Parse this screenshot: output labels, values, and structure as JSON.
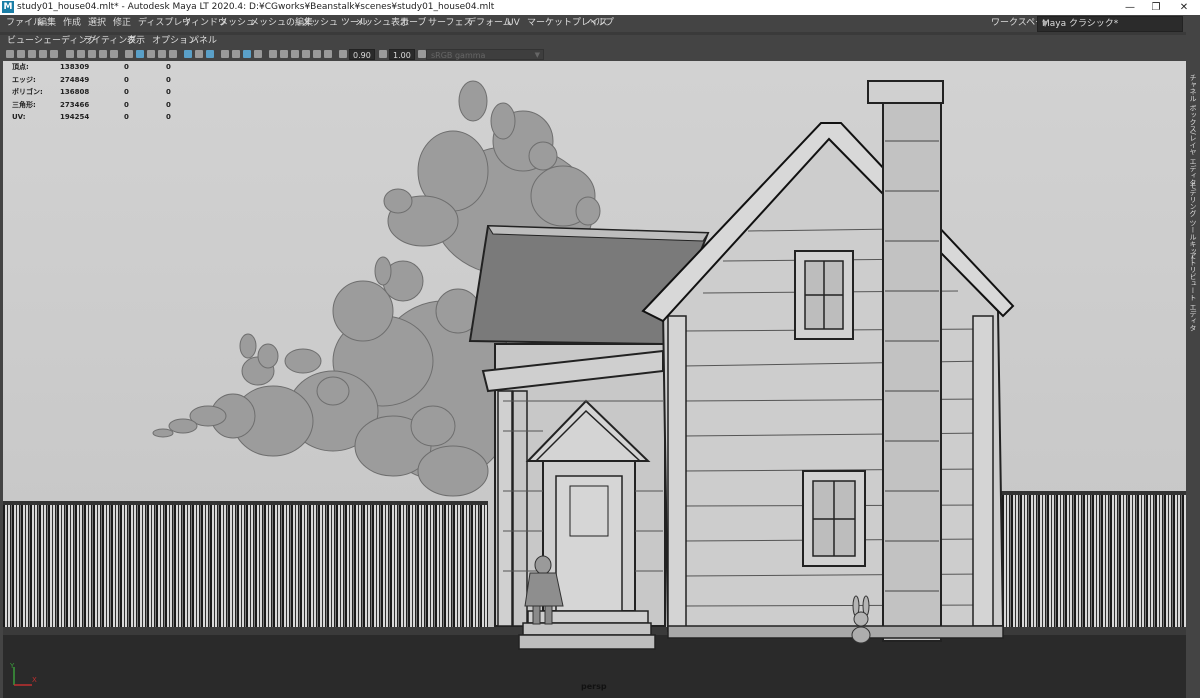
{
  "window": {
    "title": "study01_house04.mlt* - Autodesk Maya LT 2020.4: D:¥CGworks¥Beanstalk¥scenes¥study01_house04.mlt",
    "app_icon": "M",
    "controls": {
      "minimize": "—",
      "restore": "❐",
      "close": "✕"
    }
  },
  "menubar": {
    "items": [
      "ファイル",
      "編集",
      "作成",
      "選択",
      "修正",
      "ディスプレイ",
      "ウィンドウ",
      "メッシュ",
      "メッシュの編集",
      "メッシュ ツール",
      "メッシュ表示",
      "カーブ",
      "サーフェス",
      "デフォーム",
      "UV",
      "マーケットプレイス",
      "ヘルプ"
    ],
    "workspace_label": "ワークスペース:",
    "workspace_value": "Maya クラシック*"
  },
  "panel_menu": {
    "items": [
      "ビュー",
      "シェーディング",
      "ライティング",
      "表示",
      "オプション",
      "パネル"
    ]
  },
  "toolbar": {
    "exposure": "0.90",
    "gamma": "1.00",
    "color_space": "sRGB gamma",
    "accent": "#5aa0c8"
  },
  "hud": {
    "rows": [
      {
        "label": "頂点:",
        "a": "138309",
        "b": "0",
        "c": "0"
      },
      {
        "label": "エッジ:",
        "a": "274849",
        "b": "0",
        "c": "0"
      },
      {
        "label": "ポリゴン:",
        "a": "136808",
        "b": "0",
        "c": "0"
      },
      {
        "label": "三角形:",
        "a": "273466",
        "b": "0",
        "c": "0"
      },
      {
        "label": "UV:",
        "a": "194254",
        "b": "0",
        "c": "0"
      }
    ]
  },
  "viewport": {
    "camera": "persp",
    "axis": {
      "x": "X",
      "y": "Y"
    }
  },
  "right_panel": {
    "tabs": [
      "チャネル ボックス/レイヤ エディタ",
      "モデリング ツールキット",
      "アトリビュート エディタ"
    ]
  }
}
